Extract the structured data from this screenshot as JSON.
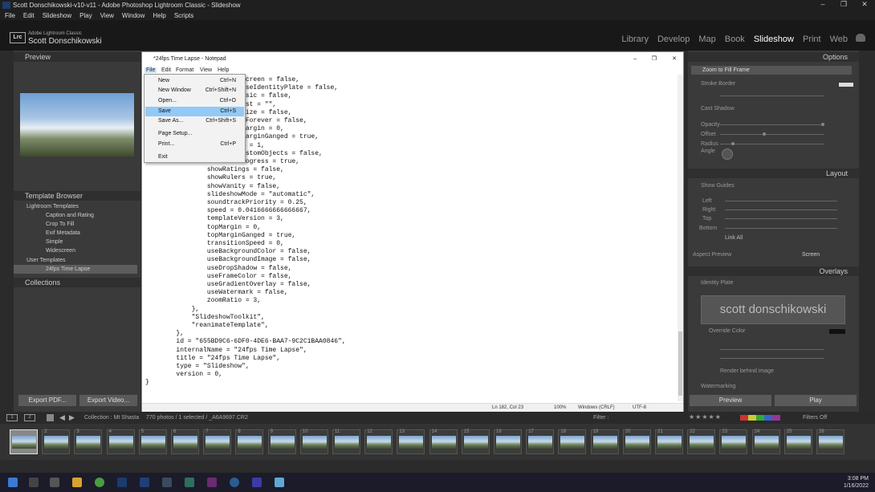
{
  "window_title": "Scott Donschikowski-v10-v11 - Adobe Photoshop Lightroom Classic - Slideshow",
  "window_controls": [
    "–",
    "❐",
    "✕"
  ],
  "menubar": [
    "File",
    "Edit",
    "Slideshow",
    "Play",
    "View",
    "Window",
    "Help",
    "Scripts"
  ],
  "identity": {
    "logo": "Lrc",
    "sub": "Adobe Lightroom Classic",
    "name": "Scott Donschikowski"
  },
  "modules": [
    "Library",
    "Develop",
    "Map",
    "Book",
    "Slideshow",
    "Print",
    "Web"
  ],
  "active_module": "Slideshow",
  "left_panel": {
    "preview": "Preview",
    "template_browser": "Template Browser",
    "tree": [
      {
        "label": "Lightroom Templates",
        "indent": 1
      },
      {
        "label": "Caption and Rating",
        "indent": 2
      },
      {
        "label": "Crop To Fill",
        "indent": 2
      },
      {
        "label": "Exif Metadata",
        "indent": 2
      },
      {
        "label": "Simple",
        "indent": 2
      },
      {
        "label": "Widescreen",
        "indent": 2
      },
      {
        "label": "User Templates",
        "indent": 1
      },
      {
        "label": "24fps Time Lapse",
        "indent": 2,
        "selected": true
      }
    ],
    "collections": "Collections",
    "export_pdf": "Export PDF...",
    "export_video": "Export Video..."
  },
  "right_panel": {
    "options": "Options",
    "zoom_to_fill": "Zoom to Fill Frame",
    "stroke_border": "Stroke Border",
    "cast_shadow": "Cast Shadow",
    "shadow_labels": [
      "Opacity",
      "Offset",
      "Radius",
      "Angle"
    ],
    "layout": "Layout",
    "show_guides": "Show Guides",
    "guide_labels": [
      "Left",
      "Right",
      "Top",
      "Bottom"
    ],
    "link_all": "Link All",
    "aspect_preview": "Aspect Preview",
    "aspect_value": "Screen",
    "overlays": "Overlays",
    "identity_plate": "Identity Plate",
    "plate_text": "scott donschikowski",
    "override_color": "Override Color",
    "render_behind": "Render behind image",
    "watermarking": "Watermarking",
    "preview_btn": "Preview",
    "play_btn": "Play"
  },
  "notepad": {
    "title": "*24fps Time Lapse - Notepad",
    "menu": [
      "File",
      "Edit",
      "Format",
      "View",
      "Help"
    ],
    "lines": [
      "                        pScreen = false,",
      "                        pUseIdentityPlate = false,",
      "                        Music = false,",
      "                        list = \"\",",
      "                        omize = false,",
      "                        atForever = false,",
      "                        tMargin = 0,",
      "                        tMarginGanged = true,",
      "                        en = 1,",
      "                        CustomObjects = false,",
      "                        Progress = true,",
      "                showRatings = false,",
      "                showRulers = true,",
      "                showVanity = false,",
      "                slideshowMode = \"automatic\",",
      "                soundtrackPriority = 0.25,",
      "                speed = 0.0416666666666667,",
      "                templateVersion = 3,",
      "                topMargin = 0,",
      "                topMarginGanged = true,",
      "                transitionSpeed = 0,",
      "                useBackgroundColor = false,",
      "                useBackgroundImage = false,",
      "                useDropShadow = false,",
      "                useFrameColor = false,",
      "                useGradientOverlay = false,",
      "                useWatermark = false,",
      "                zoomRatio = 3,",
      "            },",
      "            \"SlideshowToolkit\",",
      "            \"reanimateTemplate\",",
      "        },",
      "        id = \"655BD9C6-6DF0-4DE6-BAA7-9C2C1BAA0846\",",
      "        internalName = \"24fps Time Lapse\",",
      "        title = \"24fps Time Lapse\",",
      "        type = \"Slideshow\",",
      "        version = 0,",
      "}"
    ],
    "status": {
      "pos": "Ln 182, Col 23",
      "zoom": "100%",
      "eol": "Windows (CRLF)",
      "enc": "UTF-8"
    }
  },
  "file_menu": [
    {
      "label": "New",
      "shortcut": "Ctrl+N"
    },
    {
      "label": "New Window",
      "shortcut": "Ctrl+Shift+N"
    },
    {
      "label": "Open...",
      "shortcut": "Ctrl+O"
    },
    {
      "label": "Save",
      "shortcut": "Ctrl+S",
      "highlighted": true
    },
    {
      "label": "Save As...",
      "shortcut": "Ctrl+Shift+S"
    },
    {
      "label": "Page Setup...",
      "shortcut": ""
    },
    {
      "label": "Print...",
      "shortcut": "Ctrl+P"
    },
    {
      "label": "Exit",
      "shortcut": ""
    }
  ],
  "filmstrip": {
    "collection": "Collection : Mt Shasta",
    "count": "770 photos / 1 selected / _A6A9697.CR2",
    "filter": "Filter :",
    "filters_off": "Filters Off",
    "frames": [
      "",
      "2",
      "3",
      "4",
      "5",
      "6",
      "7",
      "8",
      "9",
      "10",
      "11",
      "12",
      "13",
      "14",
      "15",
      "16",
      "17",
      "18",
      "19",
      "20",
      "21",
      "22",
      "23",
      "24",
      "25",
      "26"
    ]
  },
  "taskbar": {
    "time": "3:08 PM",
    "date": "1/16/2022"
  }
}
